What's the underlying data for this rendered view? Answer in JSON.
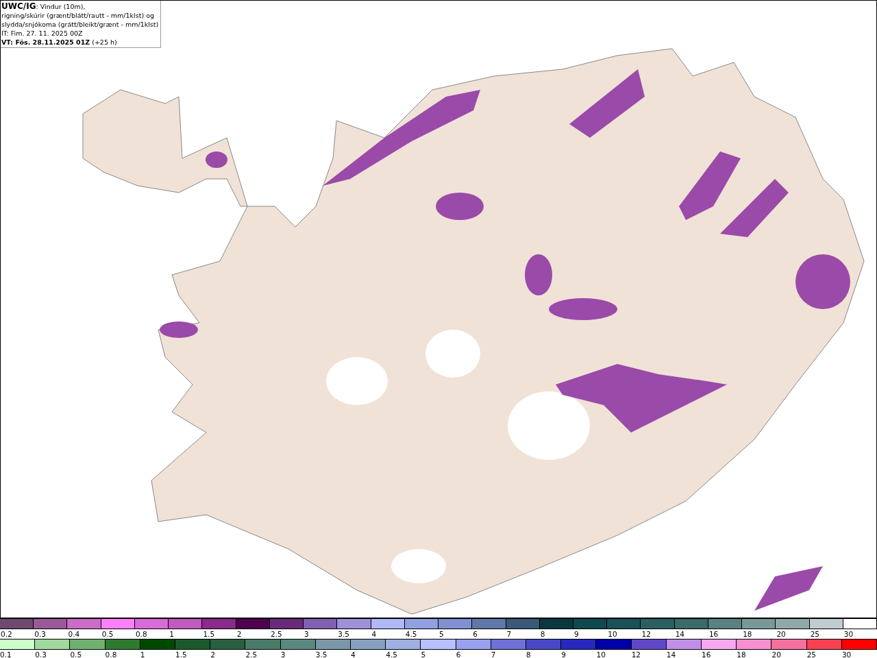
{
  "header": {
    "product": "UWC/IG",
    "description": ": Vindur (10m),",
    "line_2": "rigning/skúrir (grænt/blátt/rautt - mm/1klst) og",
    "line_3": "slydda/snjókoma (grátt/bleikt/grænt - mm/1klst)",
    "issue_time": "IT: Fim. 27. 11. 2025 00Z",
    "valid_time": "VT: Fös. 28.11.2025 01Z",
    "lead_time": "(+25 h)"
  },
  "legends": [
    {
      "kind": "snow",
      "swatches": [
        {
          "label": "0.2",
          "color": "#6e4a6e"
        },
        {
          "label": "0.3",
          "color": "#9a5a9a"
        },
        {
          "label": "0.4",
          "color": "#c96dc9"
        },
        {
          "label": "0.5",
          "color": "#ff80ff"
        },
        {
          "label": "0.8",
          "color": "#d96ad9"
        },
        {
          "label": "1",
          "color": "#c05ac0"
        },
        {
          "label": "1.5",
          "color": "#8a2a8a"
        },
        {
          "label": "2",
          "color": "#500050"
        },
        {
          "label": "2.5",
          "color": "#6a2a7a"
        },
        {
          "label": "3",
          "color": "#8060b0"
        },
        {
          "label": "3.5",
          "color": "#a090d8"
        },
        {
          "label": "4",
          "color": "#b0b8f8"
        },
        {
          "label": "4.5",
          "color": "#90a0e0"
        },
        {
          "label": "5",
          "color": "#8090d0"
        },
        {
          "label": "6",
          "color": "#6078a8"
        },
        {
          "label": "7",
          "color": "#3a5a78"
        },
        {
          "label": "8",
          "color": "#083840"
        },
        {
          "label": "9",
          "color": "#104850"
        },
        {
          "label": "10",
          "color": "#1a5058"
        },
        {
          "label": "12",
          "color": "#2a6060"
        },
        {
          "label": "14",
          "color": "#3a6a6a"
        },
        {
          "label": "16",
          "color": "#5a8080"
        },
        {
          "label": "18",
          "color": "#7a9898"
        },
        {
          "label": "20",
          "color": "#90a8a8"
        },
        {
          "label": "25",
          "color": "#c0ccd0"
        },
        {
          "label": "30",
          "color": "#ffffff"
        }
      ]
    },
    {
      "kind": "rain",
      "swatches": [
        {
          "label": "0.1",
          "color": "#ccffcc"
        },
        {
          "label": "0.3",
          "color": "#a0d8a0"
        },
        {
          "label": "0.5",
          "color": "#70b070"
        },
        {
          "label": "0.8",
          "color": "#307a30"
        },
        {
          "label": "1",
          "color": "#004800"
        },
        {
          "label": "1.5",
          "color": "#1a5a2a"
        },
        {
          "label": "2",
          "color": "#2a6040"
        },
        {
          "label": "2.5",
          "color": "#4a7a68"
        },
        {
          "label": "3",
          "color": "#5a8880"
        },
        {
          "label": "3.5",
          "color": "#7a98a8"
        },
        {
          "label": "4",
          "color": "#8aa0c0"
        },
        {
          "label": "4.5",
          "color": "#a0b0e0"
        },
        {
          "label": "5",
          "color": "#b8c0ff"
        },
        {
          "label": "6",
          "color": "#98a0f0"
        },
        {
          "label": "7",
          "color": "#7070d8"
        },
        {
          "label": "8",
          "color": "#4848c8"
        },
        {
          "label": "9",
          "color": "#2828c0"
        },
        {
          "label": "10",
          "color": "#0000a8"
        },
        {
          "label": "12",
          "color": "#6048c8"
        },
        {
          "label": "14",
          "color": "#c090e8"
        },
        {
          "label": "16",
          "color": "#f8a8f0"
        },
        {
          "label": "18",
          "color": "#f890d0"
        },
        {
          "label": "20",
          "color": "#f870a0"
        },
        {
          "label": "25",
          "color": "#f84050"
        },
        {
          "label": "30",
          "color": "#ff0000"
        }
      ]
    }
  ]
}
